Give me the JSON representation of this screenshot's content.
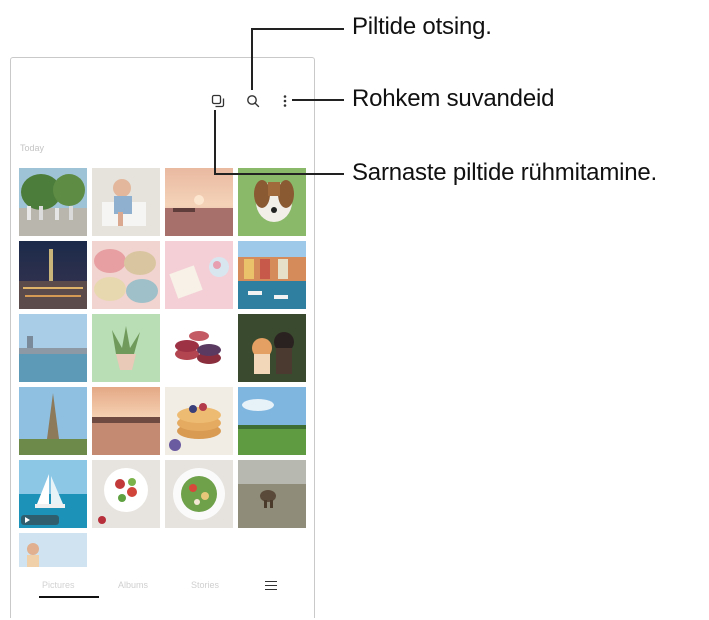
{
  "callouts": {
    "search": "Piltide otsing.",
    "more_options": "Rohkem suvandeid",
    "group_similar": "Sarnaste piltide rühmitamine."
  },
  "toolbar": {
    "group_icon": "group-similar-icon",
    "search_icon": "search-icon",
    "more_icon": "more-options-icon"
  },
  "gallery": {
    "section_label": "Today",
    "tiles": [
      {
        "name": "photo-park"
      },
      {
        "name": "photo-toddler"
      },
      {
        "name": "photo-sunset-beach"
      },
      {
        "name": "photo-beagle"
      },
      {
        "name": "photo-city-night"
      },
      {
        "name": "photo-macarons"
      },
      {
        "name": "photo-desk-flatlay"
      },
      {
        "name": "photo-harbor-houses"
      },
      {
        "name": "photo-river-bridge"
      },
      {
        "name": "photo-succulent"
      },
      {
        "name": "photo-macaron-stack"
      },
      {
        "name": "photo-kitten-puppy"
      },
      {
        "name": "photo-eiffel-tower"
      },
      {
        "name": "photo-sunset-pier"
      },
      {
        "name": "photo-pancakes"
      },
      {
        "name": "photo-meadow"
      },
      {
        "name": "video-sailboat"
      },
      {
        "name": "photo-salad-top"
      },
      {
        "name": "photo-salad-plate"
      },
      {
        "name": "photo-dog-field"
      },
      {
        "name": "photo-portrait"
      }
    ]
  },
  "bottom_nav": {
    "tabs": [
      "Pictures",
      "Albums",
      "Stories"
    ],
    "menu_icon": "menu-icon"
  }
}
